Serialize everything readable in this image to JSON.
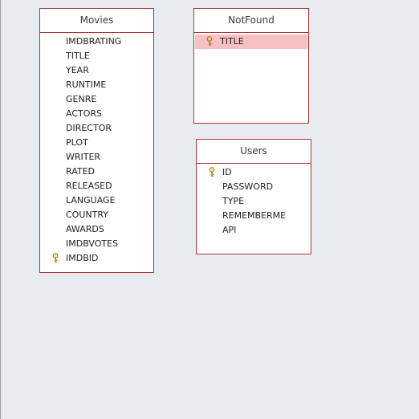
{
  "tables": {
    "movies": {
      "title": "Movies",
      "fields": [
        {
          "name": "IMDBRATING",
          "key": false
        },
        {
          "name": "TITLE",
          "key": false
        },
        {
          "name": "YEAR",
          "key": false
        },
        {
          "name": "RUNTIME",
          "key": false
        },
        {
          "name": "GENRE",
          "key": false
        },
        {
          "name": "ACTORS",
          "key": false
        },
        {
          "name": "DIRECTOR",
          "key": false
        },
        {
          "name": "PLOT",
          "key": false
        },
        {
          "name": "WRITER",
          "key": false
        },
        {
          "name": "RATED",
          "key": false
        },
        {
          "name": "RELEASED",
          "key": false
        },
        {
          "name": "LANGUAGE",
          "key": false
        },
        {
          "name": "COUNTRY",
          "key": false
        },
        {
          "name": "AWARDS",
          "key": false
        },
        {
          "name": "IMDBVOTES",
          "key": false
        },
        {
          "name": "IMDBID",
          "key": true
        }
      ]
    },
    "notfound": {
      "title": "NotFound",
      "fields": [
        {
          "name": "TITLE",
          "key": true,
          "selected": true
        }
      ]
    },
    "users": {
      "title": "Users",
      "fields": [
        {
          "name": "ID",
          "key": true
        },
        {
          "name": "PASSWORD",
          "key": false
        },
        {
          "name": "TYPE",
          "key": false
        },
        {
          "name": "REMEMBERME",
          "key": false
        },
        {
          "name": "API",
          "key": false
        }
      ]
    }
  },
  "icons": {
    "primary_key": "key-icon"
  },
  "colors": {
    "table_border": "#a4373a",
    "selected_row": "#f7c1c4",
    "key_icon": "#c9a227",
    "canvas": "#e8ebef"
  }
}
